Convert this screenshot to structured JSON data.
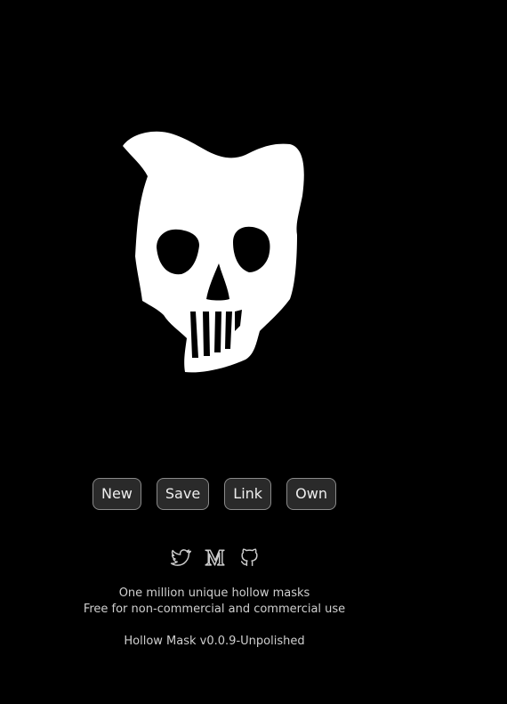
{
  "mask": {
    "icon": "skull-mask-icon",
    "fill_color": "#ffffff",
    "background_color": "#000000"
  },
  "actions": {
    "new_label": "New",
    "save_label": "Save",
    "link_label": "Link",
    "own_label": "Own"
  },
  "socials": [
    {
      "icon": "twitter-icon"
    },
    {
      "icon": "medium-icon"
    },
    {
      "icon": "github-icon"
    }
  ],
  "footer": {
    "tagline": "One million unique hollow masks",
    "license": "Free for non-commercial and commercial use",
    "version": "Hollow Mask v0.0.9-Unpolished"
  }
}
